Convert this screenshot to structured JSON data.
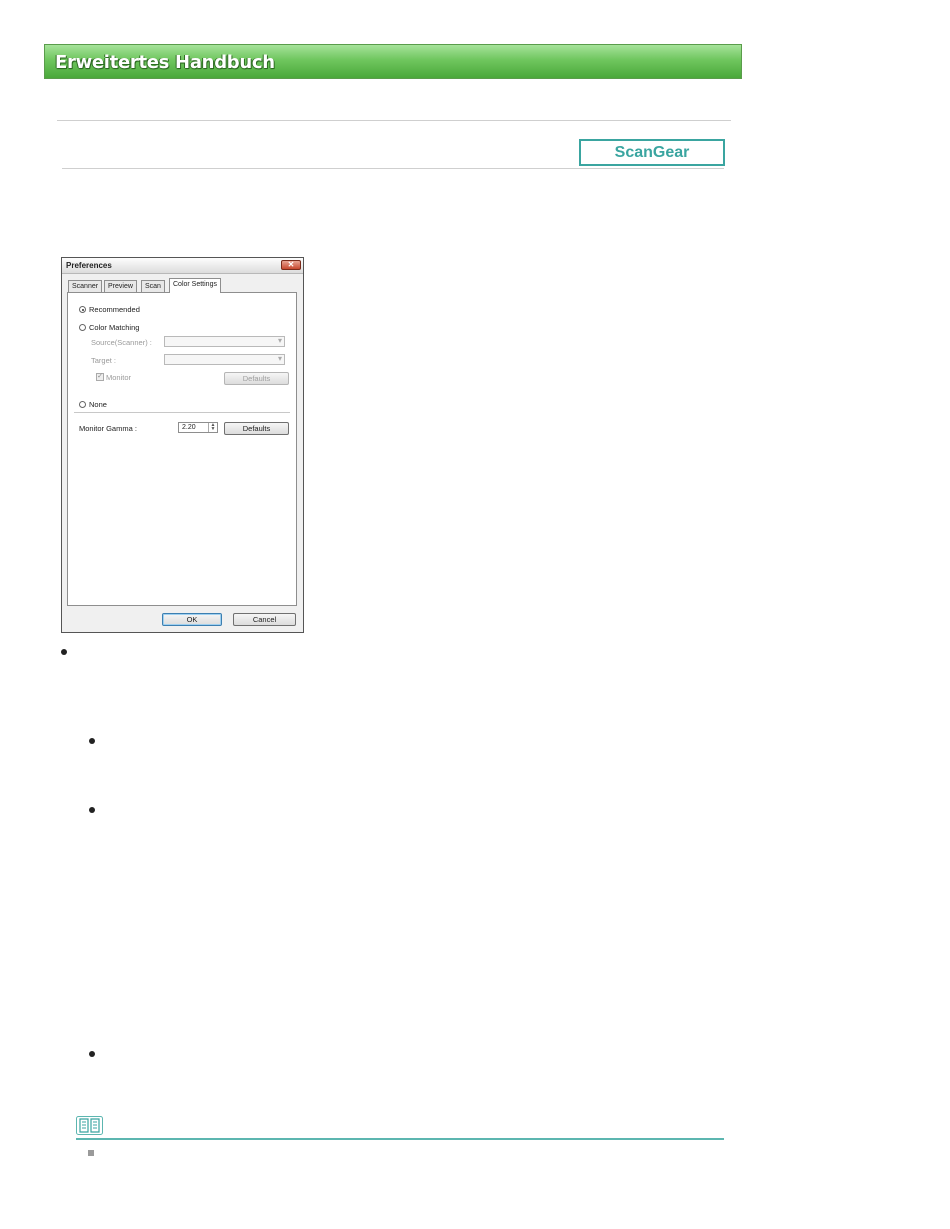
{
  "header": {
    "title": "Erweitertes Handbuch"
  },
  "product_badge": "ScanGear",
  "dialog": {
    "title": "Preferences",
    "close_glyph": "✕",
    "tabs": [
      "Scanner",
      "Preview",
      "Scan",
      "Color Settings"
    ],
    "active_tab": "Color Settings",
    "options": {
      "recommended": "Recommended",
      "color_matching": "Color Matching",
      "source_label": "Source(Scanner) :",
      "target_label": "Target :",
      "monitor_label": "Monitor",
      "none": "None",
      "monitor_gamma_label": "Monitor Gamma :",
      "monitor_gamma_value": "2.20",
      "defaults_label": "Defaults"
    },
    "buttons": {
      "ok": "OK",
      "cancel": "Cancel"
    },
    "selected_option": "Recommended"
  },
  "colors": {
    "accent_teal": "#3aa5a0",
    "banner_green": "#6fc65e"
  },
  "icons": [
    "close-icon",
    "book-note-icon",
    "bullet-icon",
    "square-bullet-icon"
  ]
}
